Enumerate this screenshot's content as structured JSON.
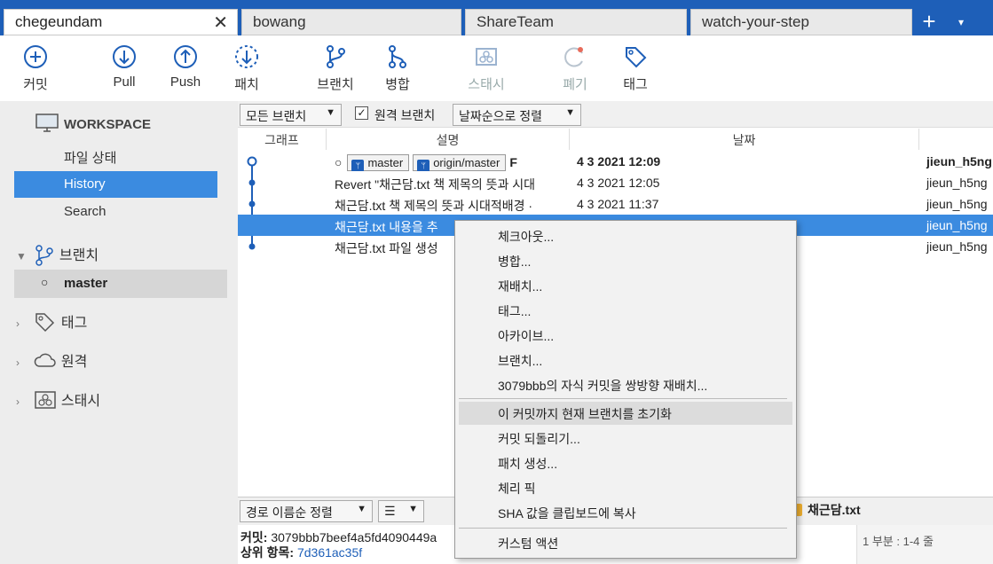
{
  "tabs": [
    {
      "label": "chegeundam",
      "active": true
    },
    {
      "label": "bowang"
    },
    {
      "label": "ShareTeam"
    },
    {
      "label": "watch-your-step"
    }
  ],
  "tab_close": "✕",
  "tab_add": "+",
  "tab_menu": "▾",
  "toolbar": {
    "commit": "커밋",
    "pull": "Pull",
    "push": "Push",
    "patch": "패치",
    "branch": "브랜치",
    "merge": "병합",
    "stash": "스태시",
    "discard": "폐기",
    "tag": "태그"
  },
  "sidebar": {
    "workspace": "WORKSPACE",
    "file_status": "파일 상태",
    "history": "History",
    "search": "Search",
    "branches": "브랜치",
    "master": "master",
    "tags": "태그",
    "remotes": "원격",
    "stashes": "스태시"
  },
  "filters": {
    "branches": "모든 브랜치",
    "remote_checked": "✓",
    "remote": "원격 브랜치",
    "sort": "날짜순으로 정렬"
  },
  "columns": {
    "graph": "그래프",
    "description": "설명",
    "date": "날짜"
  },
  "commits": [
    {
      "badges": [
        "master",
        "origin/master"
      ],
      "desc": "F",
      "date": "4 3 2021 12:09",
      "author": "jieun_h5ng"
    },
    {
      "desc": "Revert \"채근담.txt 책 제목의 뜻과 시대",
      "date": "4 3 2021 12:05",
      "author": "jieun_h5ng"
    },
    {
      "desc": "채근담.txt 책 제목의 뜻과 시대적배경 ·",
      "date": "4 3 2021 11:37",
      "author": "jieun_h5ng"
    },
    {
      "desc": "채근담.txt 내용을 추",
      "date": "",
      "author": "jieun_h5ng"
    },
    {
      "desc": "채근담.txt 파일 생성",
      "date": "",
      "author": "jieun_h5ng"
    }
  ],
  "context_menu": [
    "체크아웃...",
    "병합...",
    "재배치...",
    "태그...",
    "아카이브...",
    "브랜치...",
    "3079bbb의 자식 커밋을 쌍방향 재배치...",
    "이 커밋까지 현재 브랜치를 초기화",
    "커밋 되돌리기...",
    "패치 생성...",
    "체리 픽",
    "SHA 값을 클립보드에 복사",
    "커스텀 액션"
  ],
  "bottom": {
    "sort_files": "경로 이름순 정렬",
    "view_mode": "☰",
    "commit_label": "커밋:",
    "commit_sha": "3079bbb7beef4a5fd4090449a",
    "parent_label": "상위 항목:",
    "parent_sha": "7d361ac35f",
    "file_name": "채근담.txt",
    "hunk": "1 부분 : 1-4 줄"
  },
  "colors": {
    "accent": "#1e5fb8",
    "selection": "#3b8be0"
  }
}
